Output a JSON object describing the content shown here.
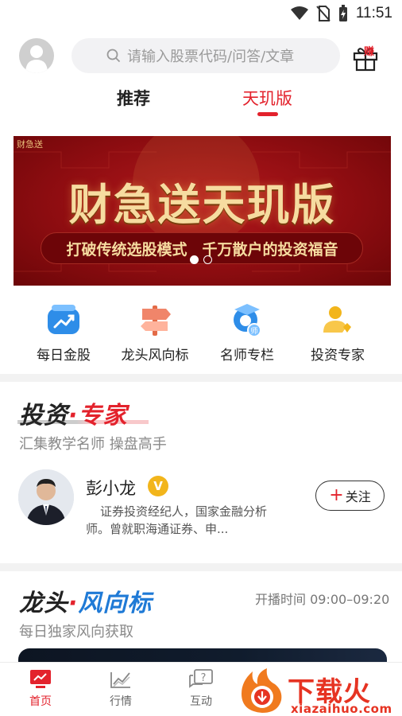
{
  "status_bar": {
    "time": "11:51"
  },
  "header": {
    "search_placeholder": "请输入股票代码/问答/文章",
    "gift_badge": "赚"
  },
  "tabs": [
    {
      "label": "推荐",
      "active": false
    },
    {
      "label": "天玑版",
      "active": true
    }
  ],
  "banner": {
    "logo_text": "财急送",
    "title": "财急送天玑版",
    "subtitle": "打破传统选股模式　千万散户的投资福音",
    "slide_count": 2,
    "active_slide": 1
  },
  "quick_links": [
    {
      "label": "每日金股",
      "icon": "trend-chart-icon"
    },
    {
      "label": "龙头风向标",
      "icon": "signpost-icon"
    },
    {
      "label": "名师专栏",
      "icon": "teacher-icon"
    },
    {
      "label": "投资专家",
      "icon": "expert-icon"
    }
  ],
  "expert_section": {
    "title_left": "投资",
    "title_sep": "·",
    "title_right": "专家",
    "description": "汇集教学名师 操盘高手",
    "expert": {
      "name": "彭小龙",
      "verified_mark": "V",
      "bio": "证券投资经纪人，国家金融分析师。曾就职海通证券、申...",
      "follow_label": "关注"
    }
  },
  "leader_section": {
    "title_left": "龙头",
    "title_sep": "·",
    "title_right": "风向标",
    "broadcast_time": "开播时间 09:00–09:20",
    "description": "每日独家风向获取"
  },
  "bottom_nav": [
    {
      "label": "首页",
      "icon": "home-monitor-icon",
      "active": true
    },
    {
      "label": "行情",
      "icon": "market-chart-icon",
      "active": false
    },
    {
      "label": "互动",
      "icon": "chat-question-icon",
      "active": false
    }
  ],
  "watermark": {
    "text": "下载火",
    "url": "xiazaihuo.com"
  },
  "colors": {
    "accent": "#e3222c",
    "blue": "#1f7ad6",
    "gold": "#f2b51b"
  }
}
